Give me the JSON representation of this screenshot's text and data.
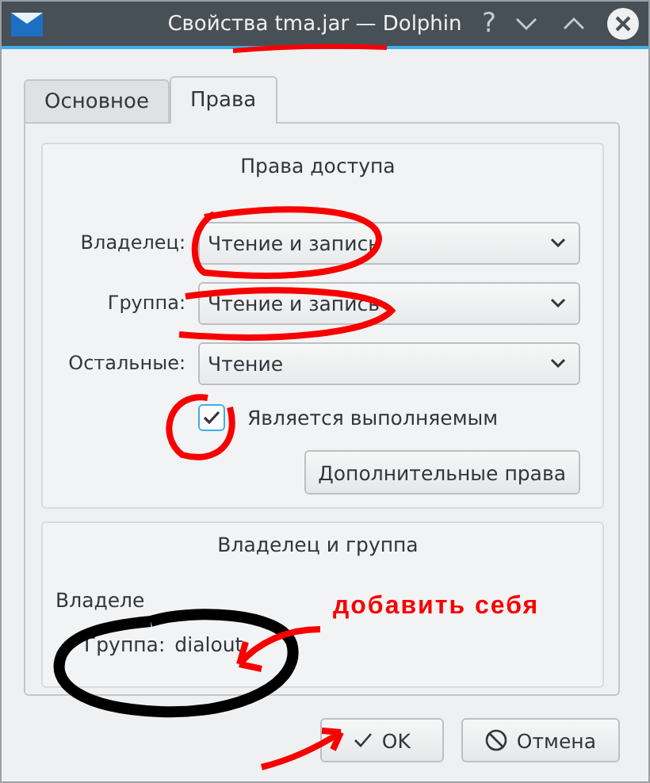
{
  "window": {
    "title": "Свойства tma.jar — Dolphin",
    "help": "?"
  },
  "tabs": [
    {
      "label": "Основное",
      "selected": false
    },
    {
      "label": "Права",
      "selected": true
    }
  ],
  "access": {
    "title": "Права доступа",
    "rows": [
      {
        "label": "Владелец:",
        "value": "Чтение и запись"
      },
      {
        "label": "Группа:",
        "value": "Чтение и запись"
      },
      {
        "label": "Остальные:",
        "value": "Чтение"
      }
    ],
    "executable": {
      "label": "Является выполняемым",
      "checked": true
    },
    "advanced_button": "Дополнительные права"
  },
  "ownership": {
    "title": "Владелец и группа",
    "owner_label": "Владеле",
    "group_label": "Группа:",
    "group_value": "dialout"
  },
  "buttons": [
    {
      "label": "OK",
      "kind": "ok"
    },
    {
      "label": "Отмена",
      "kind": "cancel"
    }
  ],
  "annotation": {
    "text": "добавить себя"
  }
}
